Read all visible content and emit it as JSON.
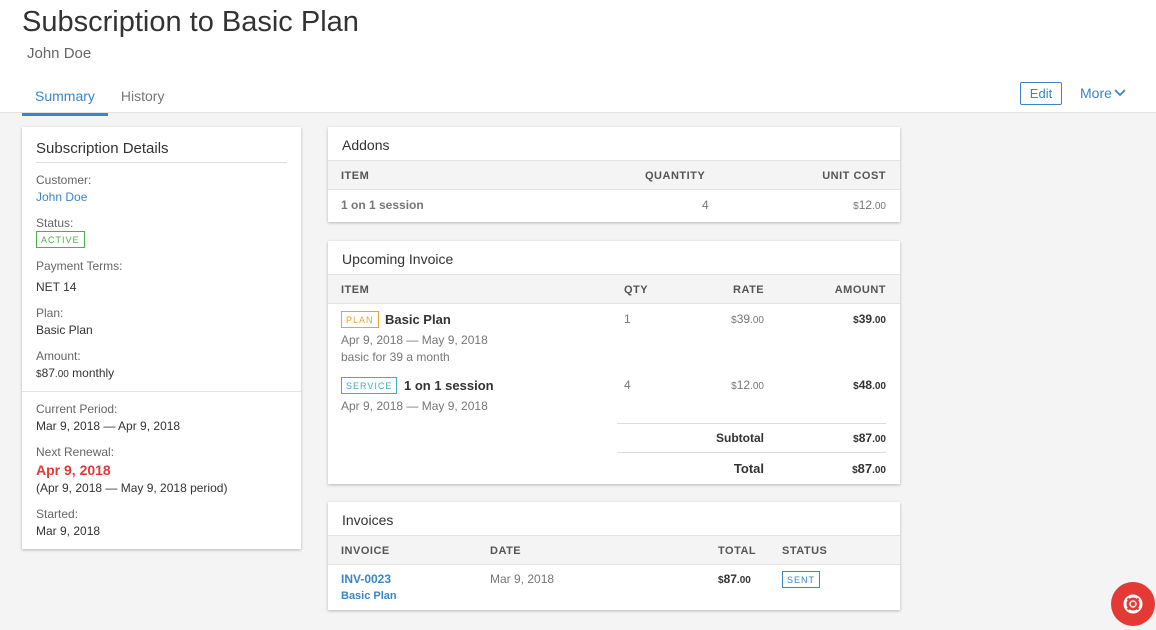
{
  "header": {
    "title": "Subscription to Basic Plan",
    "subtitle": "John Doe",
    "tabs": [
      "Summary",
      "History"
    ],
    "edit_label": "Edit",
    "more_label": "More"
  },
  "details": {
    "title": "Subscription Details",
    "customer_label": "Customer:",
    "customer_value": "John Doe",
    "status_label": "Status:",
    "status_value": "ACTIVE",
    "terms_label": "Payment Terms:",
    "terms_value": "NET 14",
    "plan_label": "Plan:",
    "plan_value": "Basic Plan",
    "amount_label": "Amount:",
    "amount_currency": "$",
    "amount_whole": "87",
    "amount_cents": ".00",
    "amount_suffix": " monthly",
    "period_label": "Current Period:",
    "period_value": "Mar 9, 2018 — Apr 9, 2018",
    "renewal_label": "Next Renewal:",
    "renewal_value": "Apr 9, 2018",
    "renewal_note": "(Apr 9, 2018 — May 9, 2018 period)",
    "started_label": "Started:",
    "started_value": "Mar 9, 2018"
  },
  "addons": {
    "title": "Addons",
    "columns": [
      "ITEM",
      "QUANTITY",
      "UNIT COST"
    ],
    "row": {
      "item": "1 on 1 session",
      "quantity": "4",
      "cost_cur": "$",
      "cost_whole": "12",
      "cost_cents": ".00"
    }
  },
  "upcoming": {
    "title": "Upcoming Invoice",
    "columns": [
      "ITEM",
      "QTY",
      "RATE",
      "AMOUNT"
    ],
    "rows": [
      {
        "tag": "PLAN",
        "name": "Basic Plan",
        "line1": "Apr 9, 2018 — May 9, 2018",
        "line2": "basic for 39 a month",
        "qty": "1",
        "rate_cur": "$",
        "rate_whole": "39",
        "rate_cents": ".00",
        "amt_cur": "$",
        "amt_whole": "39",
        "amt_cents": ".00"
      },
      {
        "tag": "SERVICE",
        "name": "1 on 1 session",
        "line1": "Apr 9, 2018 — May 9, 2018",
        "qty": "4",
        "rate_cur": "$",
        "rate_whole": "12",
        "rate_cents": ".00",
        "amt_cur": "$",
        "amt_whole": "48",
        "amt_cents": ".00"
      }
    ],
    "subtotal_label": "Subtotal",
    "subtotal_cur": "$",
    "subtotal_whole": "87",
    "subtotal_cents": ".00",
    "total_label": "Total",
    "total_cur": "$",
    "total_whole": "87",
    "total_cents": ".00"
  },
  "invoices": {
    "title": "Invoices",
    "columns": [
      "INVOICE",
      "DATE",
      "TOTAL",
      "STATUS"
    ],
    "row": {
      "number": "INV-0023",
      "plan": "Basic Plan",
      "date": "Mar 9, 2018",
      "total_cur": "$",
      "total_whole": "87",
      "total_cents": ".00",
      "status": "SENT"
    }
  },
  "colors": {
    "accent": "#3a86c8",
    "active": "#4caf50",
    "renewal": "#e53935",
    "plan_tag": "#f0a030",
    "service_tag": "#3ab0c8"
  },
  "icons": {
    "more": "chevron-down-icon",
    "help": "lifebuoy-icon"
  }
}
